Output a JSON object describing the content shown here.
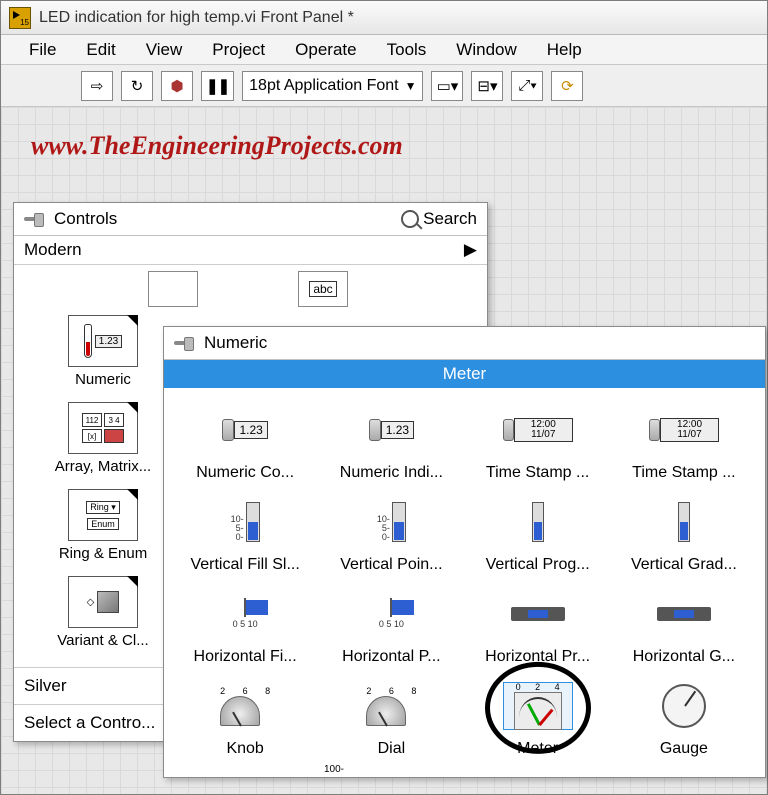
{
  "titlebar": {
    "title": "LED indication for high temp.vi Front Panel *"
  },
  "menu": {
    "items": [
      "File",
      "Edit",
      "View",
      "Project",
      "Operate",
      "Tools",
      "Window",
      "Help"
    ]
  },
  "toolbar": {
    "run_glyph": "⇨",
    "runcont_glyph": "↻",
    "stop_glyph": "⬢",
    "pause_glyph": "❚❚",
    "font_label": "18pt Application Font",
    "align_glyph": "▭▾",
    "dist_glyph": "⊟▾",
    "resize_glyph": "⤢▾",
    "reorder_glyph": "⟳"
  },
  "watermark": "www.TheEngineeringProjects.com",
  "palette": {
    "title": "Controls",
    "search": "Search",
    "sub": "Modern",
    "categories": [
      {
        "label": "Numeric",
        "sample": "1.23"
      },
      {
        "label": "Array, Matrix...",
        "sample": ""
      },
      {
        "label": "Ring & Enum",
        "sample": ""
      },
      {
        "label": "Variant & Cl...",
        "sample": ""
      }
    ],
    "top_row_abc": "abc",
    "silver": "Silver",
    "select": "Select a Contro..."
  },
  "subpalette": {
    "title": "Numeric",
    "selected": "Meter",
    "cells": [
      {
        "label": "Numeric Co...",
        "kind": "num",
        "text": "1.23"
      },
      {
        "label": "Numeric Indi...",
        "kind": "num",
        "text": "1.23"
      },
      {
        "label": "Time Stamp ...",
        "kind": "ts",
        "text": "12:00\n11/07"
      },
      {
        "label": "Time Stamp ...",
        "kind": "ts",
        "text": "12:00\n11/07"
      },
      {
        "label": "Vertical Fill Sl...",
        "kind": "vslide",
        "ticks": "10-\n5-\n0-"
      },
      {
        "label": "Vertical Poin...",
        "kind": "vslide",
        "ticks": "10-\n5-\n0-"
      },
      {
        "label": "Vertical Prog...",
        "kind": "vbar"
      },
      {
        "label": "Vertical Grad...",
        "kind": "vbar"
      },
      {
        "label": "Horizontal Fi...",
        "kind": "hslide",
        "ticks": "0  5  10"
      },
      {
        "label": "Horizontal P...",
        "kind": "hslide",
        "ticks": "0  5  10"
      },
      {
        "label": "Horizontal Pr...",
        "kind": "hbar"
      },
      {
        "label": "Horizontal G...",
        "kind": "hbar"
      },
      {
        "label": "Knob",
        "kind": "knob",
        "ticks": "2 6 8",
        "halo": false
      },
      {
        "label": "Dial",
        "kind": "knob",
        "ticks": "2 6 8",
        "halo": false
      },
      {
        "label": "Meter",
        "kind": "meter",
        "ticks": "0 2 4",
        "halo": true,
        "selected": true
      },
      {
        "label": "Gauge",
        "kind": "gauge",
        "ticks": "",
        "halo": false
      }
    ],
    "footer_ticks": "100-"
  }
}
